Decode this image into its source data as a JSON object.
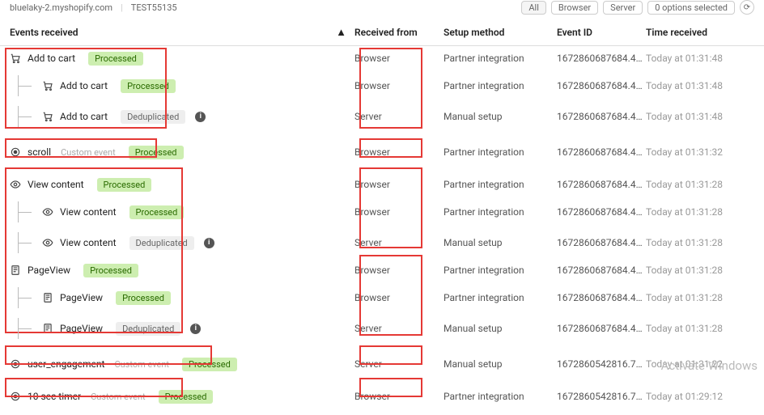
{
  "topbar": {
    "domain": "bluelaky-2.myshopify.com",
    "test_id": "TEST55135",
    "filter_all": "All",
    "filter_browser": "Browser",
    "filter_server": "Server",
    "options": "0 options selected"
  },
  "headers": {
    "events": "Events received",
    "received": "Received from",
    "setup": "Setup method",
    "event_id": "Event ID",
    "time": "Time received"
  },
  "labels": {
    "processed": "Processed",
    "deduplicated": "Deduplicated",
    "custom_event": "Custom event"
  },
  "events": [
    {
      "name": "Add to cart",
      "icon": "cart",
      "status": "processed",
      "recv": "Browser",
      "setup": "Partner integration",
      "id": "1672860687684.49…",
      "time": "Today at 01:31:48"
    },
    {
      "name": "Add to cart",
      "icon": "cart",
      "status": "processed",
      "recv": "Browser",
      "setup": "Partner integration",
      "id": "1672860687684.49…",
      "time": "Today at 01:31:48"
    },
    {
      "name": "Add to cart",
      "icon": "cart",
      "status": "dedup",
      "recv": "Server",
      "setup": "Manual setup",
      "id": "1672860687684.49…",
      "time": "Today at 01:31:48"
    },
    {
      "name": "scroll",
      "icon": "target",
      "custom": true,
      "status": "processed",
      "recv": "Browser",
      "setup": "Partner integration",
      "id": "1672860687684.49…",
      "time": "Today at 01:31:32"
    },
    {
      "name": "View content",
      "icon": "eye",
      "status": "processed",
      "recv": "Browser",
      "setup": "Partner integration",
      "id": "1672860687684.49…",
      "time": "Today at 01:31:28"
    },
    {
      "name": "View content",
      "icon": "eye",
      "status": "processed",
      "recv": "Browser",
      "setup": "Partner integration",
      "id": "1672860687684.49…",
      "time": "Today at 01:31:28"
    },
    {
      "name": "View content",
      "icon": "eye",
      "status": "dedup",
      "recv": "Server",
      "setup": "Manual setup",
      "id": "1672860687684.49…",
      "time": "Today at 01:31:28"
    },
    {
      "name": "PageView",
      "icon": "page",
      "status": "processed",
      "recv": "Browser",
      "setup": "Partner integration",
      "id": "1672860687684.49…",
      "time": "Today at 01:31:28"
    },
    {
      "name": "PageView",
      "icon": "page",
      "status": "processed",
      "recv": "Browser",
      "setup": "Partner integration",
      "id": "1672860687684.49…",
      "time": "Today at 01:31:28"
    },
    {
      "name": "PageView",
      "icon": "page",
      "status": "dedup",
      "recv": "Server",
      "setup": "Manual setup",
      "id": "1672860687684.49…",
      "time": "Today at 01:31:28"
    },
    {
      "name": "user_engagement",
      "icon": "target",
      "custom": true,
      "status": "processed",
      "recv": "Server",
      "setup": "Manual setup",
      "id": "1672860542816.70…",
      "time": "Today at 01:31:22"
    },
    {
      "name": "10 sec timer",
      "icon": "target",
      "custom": true,
      "status": "processed",
      "recv": "Browser",
      "setup": "Partner integration",
      "id": "1672860542816.70…",
      "time": "Today at 01:29:12"
    }
  ],
  "watermark": "Activate Windows"
}
